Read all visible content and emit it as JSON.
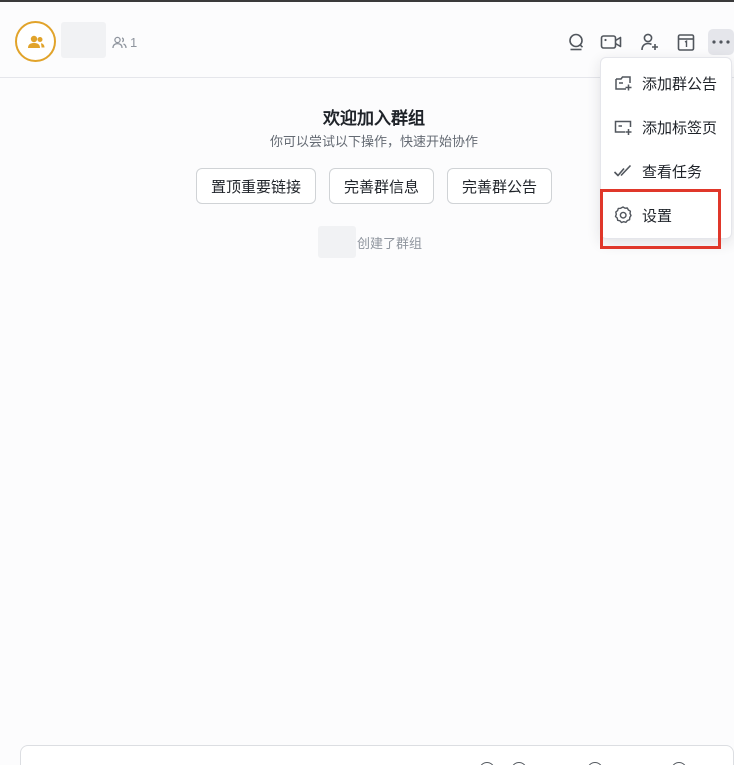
{
  "header": {
    "member_count": "1",
    "icons": [
      "search-icon",
      "video-call-icon",
      "add-member-icon",
      "calendar-icon",
      "more-icon"
    ]
  },
  "welcome": {
    "title": "欢迎加入群组",
    "subtitle": "你可以尝试以下操作，快速开始协作",
    "actions": [
      "置顶重要链接",
      "完善群信息",
      "完善群公告"
    ]
  },
  "system_message": "创建了群组",
  "more_menu": {
    "items": [
      {
        "label": "添加群公告",
        "icon": "announcement-add-icon"
      },
      {
        "label": "添加标签页",
        "icon": "tab-add-icon"
      },
      {
        "label": "查看任务",
        "icon": "task-check-icon"
      },
      {
        "label": "设置",
        "icon": "gear-icon"
      }
    ],
    "highlighted_item": "设置"
  },
  "colors": {
    "accent_gold": "#e1a32a",
    "highlight_red": "#e0372a",
    "text_primary": "#1f2329",
    "text_secondary": "#8f959e"
  }
}
